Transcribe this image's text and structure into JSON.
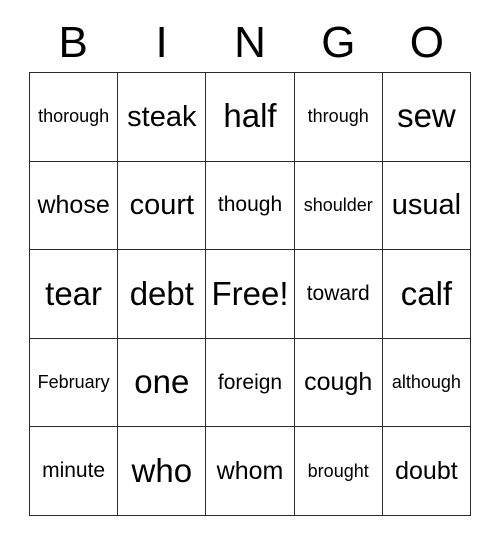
{
  "card": {
    "title": "BINGO",
    "header": {
      "letters": [
        "B",
        "I",
        "N",
        "G",
        "O"
      ]
    },
    "grid": {
      "rows": 5,
      "columns": 5,
      "free_space": {
        "row": 2,
        "column": 2,
        "label": "Free!"
      },
      "cells": [
        [
          {
            "text": "thorough",
            "size": "fs-sm"
          },
          {
            "text": "steak",
            "size": "fs-xl"
          },
          {
            "text": "half",
            "size": "fs-xxl"
          },
          {
            "text": "through",
            "size": "fs-sm"
          },
          {
            "text": "sew",
            "size": "fs-xxl"
          }
        ],
        [
          {
            "text": "whose",
            "size": "fs-lg"
          },
          {
            "text": "court",
            "size": "fs-xl"
          },
          {
            "text": "though",
            "size": "fs-md"
          },
          {
            "text": "shoulder",
            "size": "fs-sm"
          },
          {
            "text": "usual",
            "size": "fs-xl"
          }
        ],
        [
          {
            "text": "tear",
            "size": "fs-xxl"
          },
          {
            "text": "debt",
            "size": "fs-xxl"
          },
          {
            "text": "Free!",
            "size": "fs-xxl"
          },
          {
            "text": "toward",
            "size": "fs-md"
          },
          {
            "text": "calf",
            "size": "fs-xxl"
          }
        ],
        [
          {
            "text": "February",
            "size": "fs-sm"
          },
          {
            "text": "one",
            "size": "fs-xxl"
          },
          {
            "text": "foreign",
            "size": "fs-md"
          },
          {
            "text": "cough",
            "size": "fs-lg"
          },
          {
            "text": "although",
            "size": "fs-sm"
          }
        ],
        [
          {
            "text": "minute",
            "size": "fs-md"
          },
          {
            "text": "who",
            "size": "fs-xxl"
          },
          {
            "text": "whom",
            "size": "fs-lg"
          },
          {
            "text": "brought",
            "size": "fs-sm"
          },
          {
            "text": "doubt",
            "size": "fs-lg"
          }
        ]
      ]
    },
    "colors": {
      "background": "#ffffff",
      "text": "#000000",
      "grid_line": "#2b2b2b"
    }
  }
}
